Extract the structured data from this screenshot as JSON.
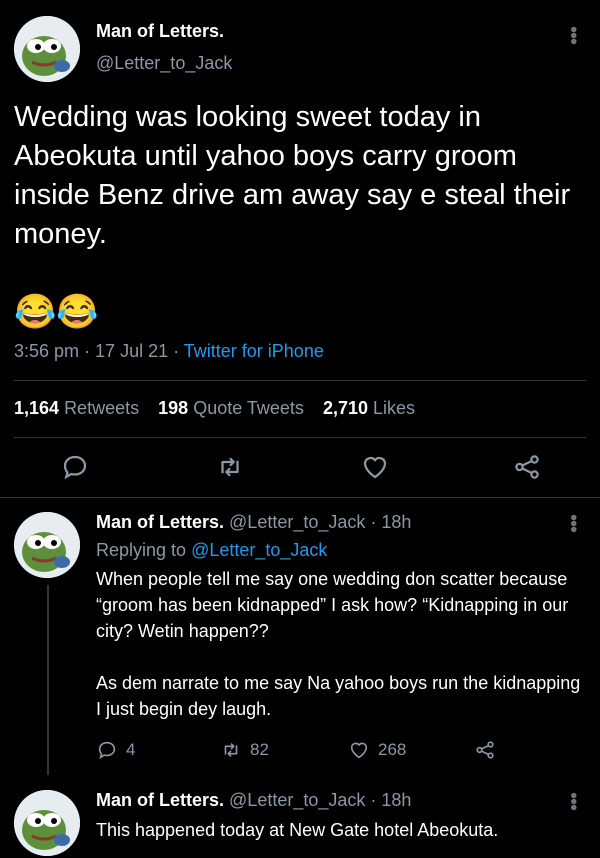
{
  "main_tweet": {
    "name": "Man of Letters.",
    "handle": "@Letter_to_Jack",
    "text": "Wedding was looking sweet today in Abeokuta until yahoo boys carry groom inside Benz drive am away say e steal their money.",
    "emoji": "😂😂",
    "time": "3:56 pm",
    "date": "17 Jul 21",
    "source": "Twitter for iPhone",
    "retweets_count": "1,164",
    "retweets_label": "Retweets",
    "quotes_count": "198",
    "quotes_label": "Quote Tweets",
    "likes_count": "2,710",
    "likes_label": "Likes"
  },
  "reply_1": {
    "name": "Man of Letters.",
    "handle": "@Letter_to_Jack",
    "age": "18h",
    "replying_prefix": "Replying to",
    "replying_to": "@Letter_to_Jack",
    "text": "When people tell me say one wedding don scatter because “groom has been kidnapped” I ask how? “Kidnapping in our city? Wetin happen??\n\nAs dem narrate to me say Na yahoo boys run the kidnapping I just begin dey laugh.",
    "replies": "4",
    "retweets": "82",
    "likes": "268"
  },
  "reply_2": {
    "name": "Man of Letters.",
    "handle": "@Letter_to_Jack",
    "age": "18h",
    "text": "This happened today at New Gate hotel Abeokuta."
  },
  "colors": {
    "background": "#000000",
    "muted": "#8b98a5",
    "link": "#1d9bf0",
    "divider": "#2f3336"
  }
}
